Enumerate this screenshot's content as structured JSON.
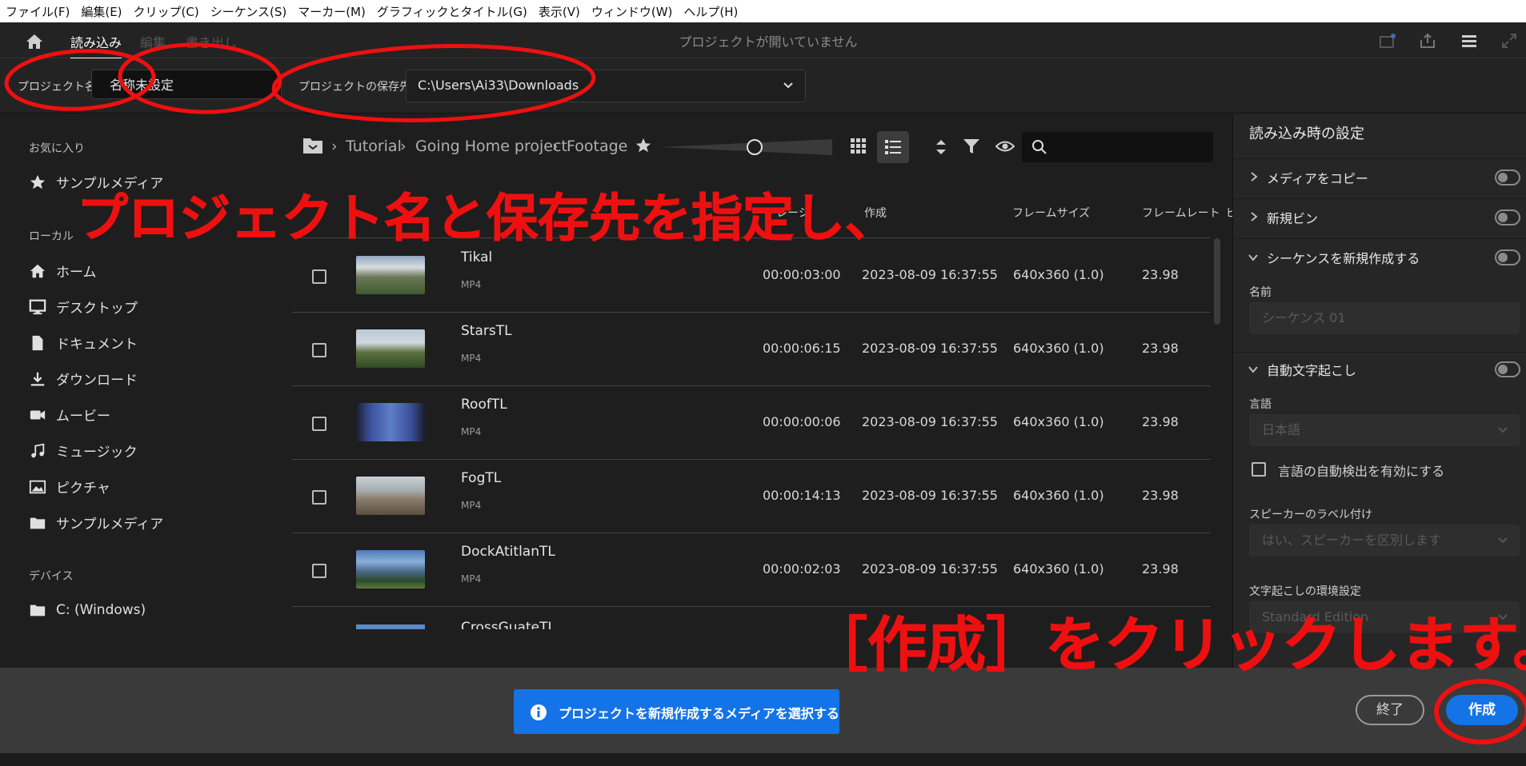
{
  "menubar": [
    "ファイル(F)",
    "編集(E)",
    "クリップ(C)",
    "シーケンス(S)",
    "マーカー(M)",
    "グラフィックとタイトル(G)",
    "表示(V)",
    "ウィンドウ(W)",
    "ヘルプ(H)"
  ],
  "header": {
    "tabs": {
      "import": "読み込み",
      "edit": "編集",
      "export": "書き出し"
    },
    "title": "プロジェクトが開いていません"
  },
  "project": {
    "name_label": "プロジェクト名",
    "name_value": "名称未設定",
    "location_label": "プロジェクトの保存先",
    "location_value": "C:\\Users\\Ai33\\Downloads"
  },
  "sidebar": {
    "favorites_heading": "お気に入り",
    "favorites": [
      {
        "label": "サンプルメディア",
        "icon": "star-icon"
      }
    ],
    "local_heading": "ローカル",
    "local": [
      {
        "label": "ホーム",
        "icon": "home-icon"
      },
      {
        "label": "デスクトップ",
        "icon": "desktop-icon"
      },
      {
        "label": "ドキュメント",
        "icon": "document-icon"
      },
      {
        "label": "ダウンロード",
        "icon": "download-icon"
      },
      {
        "label": "ムービー",
        "icon": "movie-icon"
      },
      {
        "label": "ミュージック",
        "icon": "music-icon"
      },
      {
        "label": "ピクチャ",
        "icon": "picture-icon"
      },
      {
        "label": "サンプルメディア",
        "icon": "folder-icon"
      }
    ],
    "devices_heading": "デバイス",
    "devices": [
      {
        "label": "C: (Windows)",
        "icon": "folder-icon"
      }
    ]
  },
  "browser": {
    "breadcrumb": [
      "Tutorial",
      "Going Home project",
      "Footage"
    ],
    "columns": {
      "duration_partial": "レーシ",
      "date_partial": "作成",
      "frame_size": "フレームサイズ",
      "frame_rate": "フレームレート",
      "extra": "ピ"
    },
    "rows": [
      {
        "name": "Tikal",
        "type": "MP4",
        "duration": "00:00:03:00",
        "date": "2023-08-09 16:37:55",
        "size": "640x360 (1.0)",
        "rate": "23.98"
      },
      {
        "name": "StarsTL",
        "type": "MP4",
        "duration": "00:00:06:15",
        "date": "2023-08-09 16:37:55",
        "size": "640x360 (1.0)",
        "rate": "23.98"
      },
      {
        "name": "RoofTL",
        "type": "MP4",
        "duration": "00:00:00:06",
        "date": "2023-08-09 16:37:55",
        "size": "640x360 (1.0)",
        "rate": "23.98"
      },
      {
        "name": "FogTL",
        "type": "MP4",
        "duration": "00:00:14:13",
        "date": "2023-08-09 16:37:55",
        "size": "640x360 (1.0)",
        "rate": "23.98"
      },
      {
        "name": "DockAtitlanTL",
        "type": "MP4",
        "duration": "00:00:02:03",
        "date": "2023-08-09 16:37:55",
        "size": "640x360 (1.0)",
        "rate": "23.98"
      }
    ],
    "partial_row_name": "CrossGuateTL"
  },
  "settings": {
    "title": "読み込み時の設定",
    "copy_media": "メディアをコピー",
    "new_bin": "新規ビン",
    "new_sequence": "シーケンスを新規作成する",
    "name_label": "名前",
    "name_placeholder": "シーケンス 01",
    "auto_transcribe": "自動文字起こし",
    "language_label": "言語",
    "language_value": "日本語",
    "auto_detect": "言語の自動検出を有効にする",
    "speaker_label": "スピーカーのラベル付け",
    "speaker_value": "はい、スピーカーを区別します",
    "env_label": "文字起こしの環境設定",
    "env_value": "Standard Edition"
  },
  "footer": {
    "info": "プロジェクトを新規作成するメディアを選択する",
    "exit": "終了",
    "create": "作成"
  },
  "annotations": {
    "top": "プロジェクト名と保存先を指定し、",
    "bottom": "［作成］をクリックします。"
  },
  "colors": {
    "accent": "#1473e6",
    "annotation": "#ee1010",
    "info_bg": "#1473e6"
  }
}
